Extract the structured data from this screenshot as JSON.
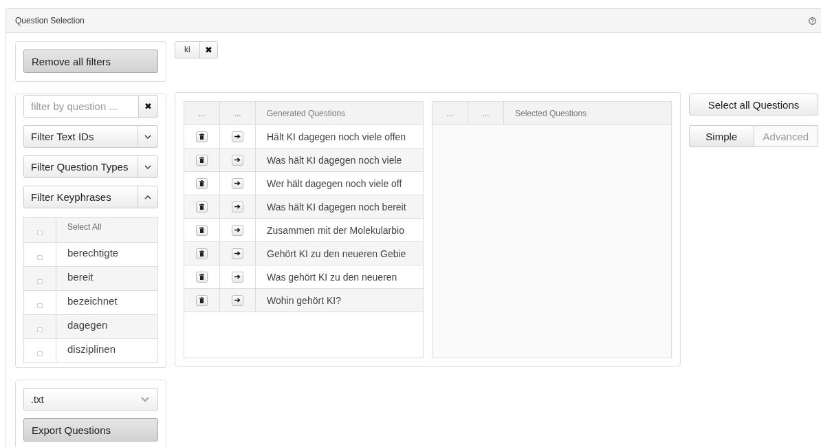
{
  "panel": {
    "title": "Question Selection"
  },
  "remove_filters": "Remove all filters",
  "active_filters": [
    {
      "label": "ki",
      "remove": "✖"
    }
  ],
  "question_filter": {
    "placeholder": "filter by question ...",
    "clear": "✖"
  },
  "dropdowns": [
    {
      "label": "Filter Text IDs",
      "expanded": false
    },
    {
      "label": "Filter Question Types",
      "expanded": false
    },
    {
      "label": "Filter Keyphrases",
      "expanded": true
    }
  ],
  "keyphrases": {
    "header": {
      "label": "Select All",
      "checked": false
    },
    "items": [
      {
        "label": "berechtigte",
        "checked": false
      },
      {
        "label": "bereit",
        "checked": false
      },
      {
        "label": "bezeichnet",
        "checked": false
      },
      {
        "label": "dagegen",
        "checked": false
      },
      {
        "label": "disziplinen",
        "checked": false
      }
    ]
  },
  "export": {
    "format": ".txt",
    "button": "Export Questions"
  },
  "generated_table": {
    "columns": [
      "...",
      "...",
      "Generated Questions"
    ],
    "rows": [
      "Hält KI dagegen noch viele offen",
      "Was hält KI dagegen noch viele",
      "Wer hält dagegen noch viele off",
      "Was hält KI dagegen noch bereit",
      "Zusammen mit der Molekularbio",
      "Gehört KI zu den neueren Gebie",
      "Was gehört KI zu den neueren",
      "Wohin gehört KI?"
    ]
  },
  "selected_table": {
    "columns": [
      "...",
      "...",
      "Selected Questions"
    ]
  },
  "select_all": "Select all Questions",
  "modes": [
    {
      "label": "Simple",
      "selected": true
    },
    {
      "label": "Advanced",
      "selected": false
    }
  ]
}
